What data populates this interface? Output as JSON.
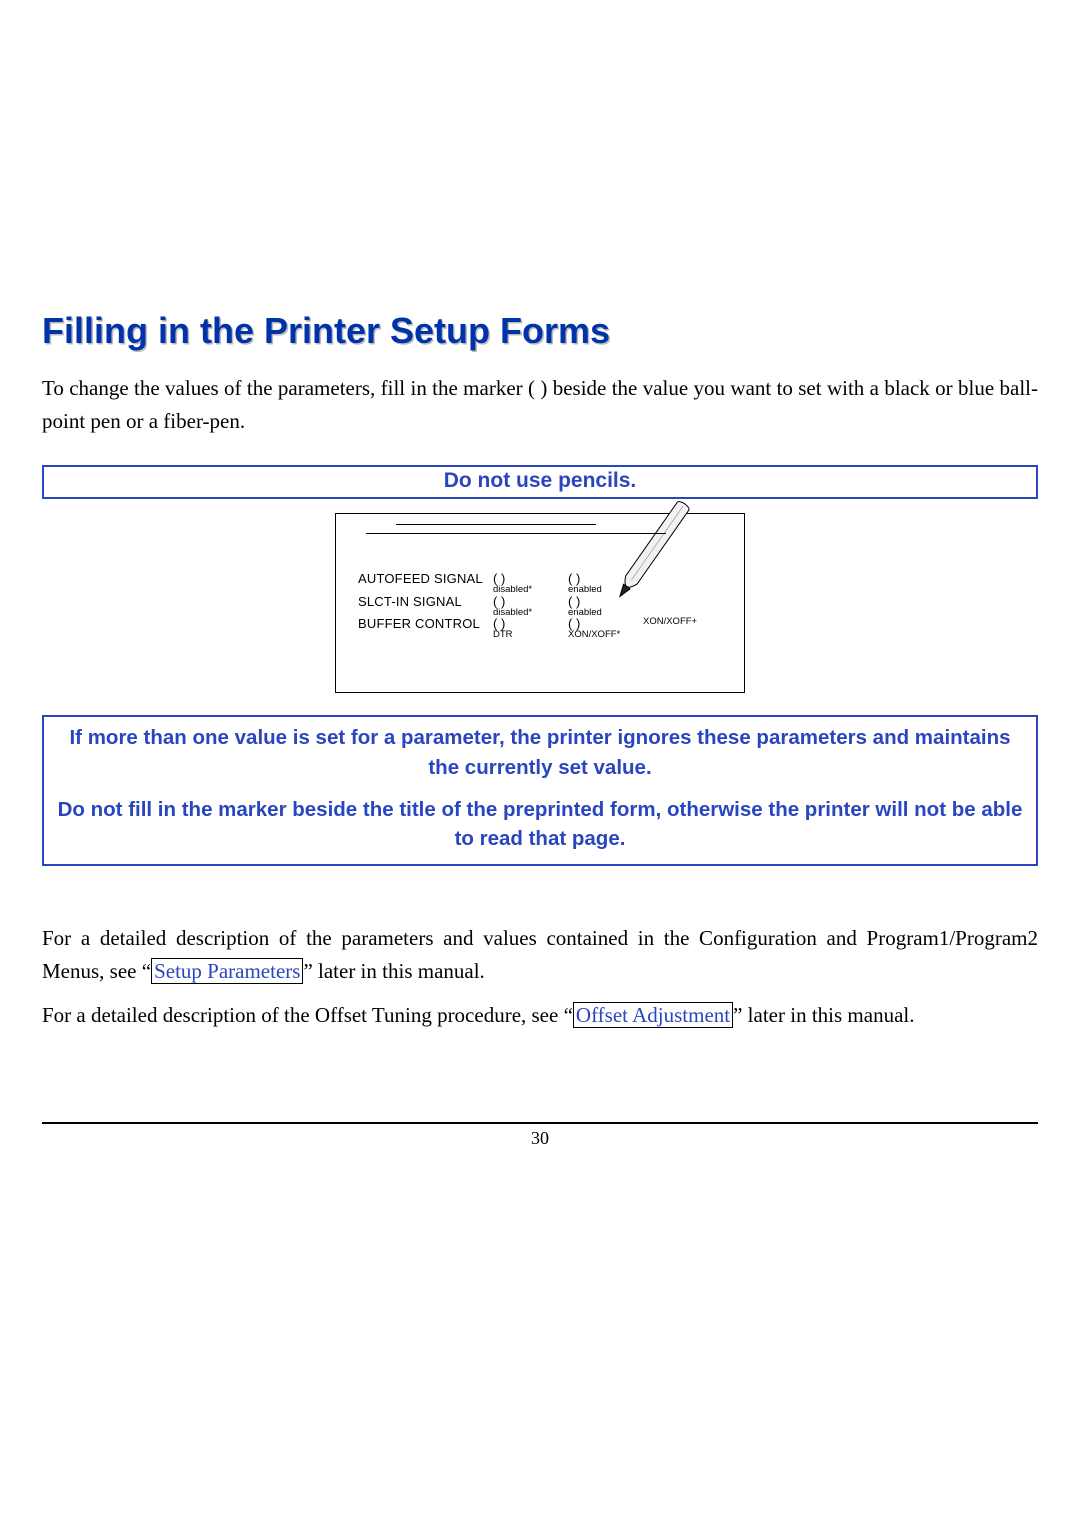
{
  "heading": "Filling in the Printer Setup Forms",
  "intro": "To change the values of the parameters, fill in the marker ( ) beside the value you want to set with a black or blue ball-point pen or a fiber-pen.",
  "callout1": "Do not use pencils.",
  "diagram": {
    "rows": [
      {
        "label": "AUTOFEED SIGNAL",
        "c1_top": "(  )",
        "c1_bot": "disabled*",
        "c2_top": "(  )",
        "c2_bot": "enabled",
        "c3_top": "",
        "c3_bot": ""
      },
      {
        "label": "SLCT-IN SIGNAL",
        "c1_top": "(  )",
        "c1_bot": "disabled*",
        "c2_top": "(  )",
        "c2_bot": "enabled",
        "c3_top": "",
        "c3_bot": ""
      },
      {
        "label": "BUFFER CONTROL",
        "c1_top": "(  )",
        "c1_bot": "DTR",
        "c2_top": "(  )",
        "c2_bot": "XON/XOFF*",
        "c3_top": "",
        "c3_bot": "XON/XOFF+"
      }
    ]
  },
  "callout2_line1": "If more than one value is set for a parameter, the printer ignores these parameters and maintains the currently set value.",
  "callout2_line2": "Do not fill in the marker beside the title of the preprinted form, otherwise the printer will not be able to read that page.",
  "para1_a": "For a detailed description of the parameters and values contained in the Configuration and Program1/Program2 Menus, see “",
  "para1_link": "Setup Parameters",
  "para1_b": "” later in this manual.",
  "para2_a": "For a detailed description of the Offset Tuning procedure, see “",
  "para2_link": "Offset Adjustment",
  "para2_b": "” later in this manual.",
  "pagenum": "30"
}
